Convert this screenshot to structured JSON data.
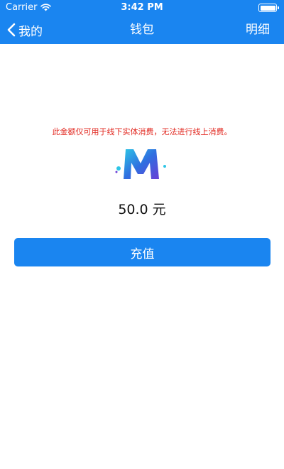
{
  "status_bar": {
    "carrier": "Carrier",
    "time": "3:42 PM",
    "wifi_icon": "wifi-icon",
    "battery_icon": "battery-icon"
  },
  "nav": {
    "back_label": "我的",
    "back_icon": "chevron-left-icon",
    "title": "钱包",
    "detail_label": "明细"
  },
  "wallet": {
    "notice": "此金额仅可用于线下实体消费，无法进行线上消费。",
    "logo_icon": "m-logo-icon",
    "balance": "50.0 元",
    "recharge_label": "充值"
  },
  "colors": {
    "primary": "#1a85f0",
    "notice_text": "#e22a22",
    "background": "#ffffff"
  }
}
